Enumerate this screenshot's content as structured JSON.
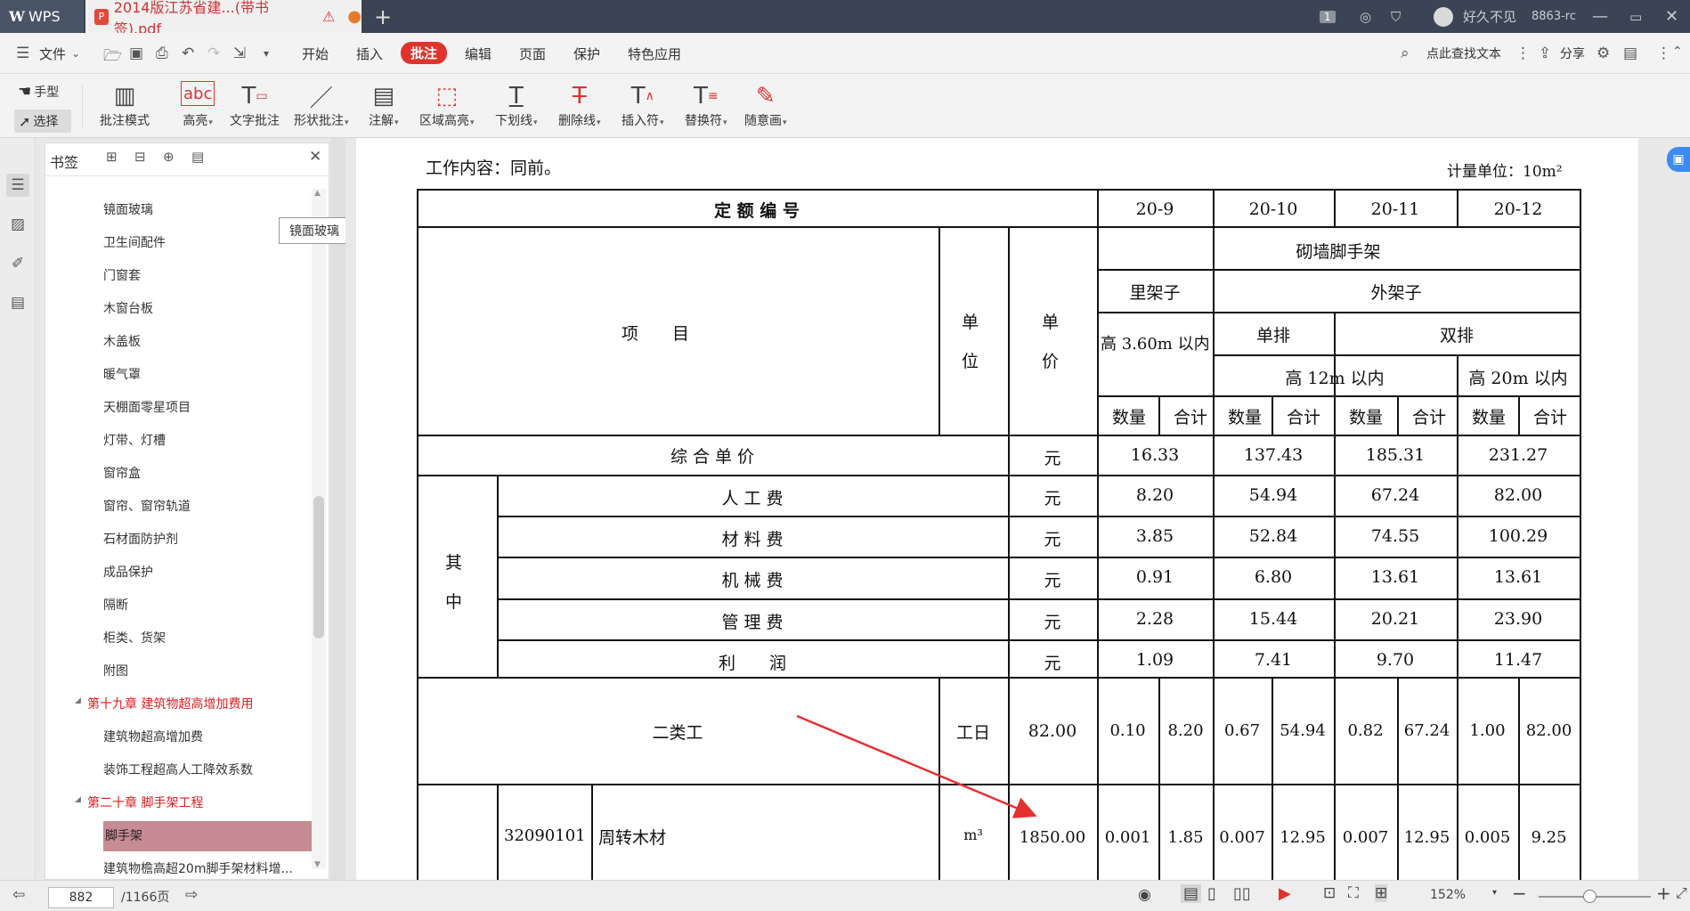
{
  "titlebar": {
    "app_name": "WPS",
    "doc_tab_title": "2014版江苏省建...(带书签).pdf",
    "user_name": "好久不见",
    "user_id": "8863-rc",
    "badge": "1"
  },
  "menubar": {
    "file_label": "文件",
    "items": [
      "开始",
      "插入",
      "批注",
      "编辑",
      "页面",
      "保护",
      "特色应用"
    ],
    "active_item": "批注",
    "search_label": "点此查找文本",
    "share_label": "分享"
  },
  "toolbar": {
    "hand_label": "手型",
    "select_label": "选择",
    "tools": [
      "批注模式",
      "高亮",
      "文字批注",
      "形状批注",
      "注解",
      "区域高亮",
      "下划线",
      "删除线",
      "插入符",
      "替换符",
      "随意画"
    ]
  },
  "bookmarks": {
    "title": "书签",
    "tooltip": "镜面玻璃",
    "items": [
      {
        "label": "镜面玻璃",
        "level": 2
      },
      {
        "label": "卫生间配件",
        "level": 2
      },
      {
        "label": "门窗套",
        "level": 2
      },
      {
        "label": "木窗台板",
        "level": 2
      },
      {
        "label": "木盖板",
        "level": 2
      },
      {
        "label": "暖气罩",
        "level": 2
      },
      {
        "label": "天棚面零星项目",
        "level": 2
      },
      {
        "label": "灯带、灯槽",
        "level": 2
      },
      {
        "label": "窗帘盒",
        "level": 2
      },
      {
        "label": "窗帘、窗帘轨道",
        "level": 2
      },
      {
        "label": "石材面防护剂",
        "level": 2
      },
      {
        "label": "成品保护",
        "level": 2
      },
      {
        "label": "隔断",
        "level": 2
      },
      {
        "label": "柜类、货架",
        "level": 2
      },
      {
        "label": "附图",
        "level": 2
      },
      {
        "label": "第十九章 建筑物超高增加费用",
        "level": 1
      },
      {
        "label": "建筑物超高增加费",
        "level": 2
      },
      {
        "label": "装饰工程超高人工降效系数",
        "level": 2
      },
      {
        "label": "第二十章 脚手架工程",
        "level": 1
      },
      {
        "label": "脚手架",
        "level": 2,
        "selected": true
      },
      {
        "label": "建筑物檐高超20m脚手架材料增...",
        "level": 2
      }
    ]
  },
  "document": {
    "work_content": "工作内容：同前。",
    "unit_note": "计量单位：10m²",
    "quota_label": "定 额 编 号",
    "codes": [
      "20-9",
      "20-10",
      "20-11",
      "20-12"
    ],
    "category": "砌墙脚手架",
    "inner_frame": "里架子",
    "outer_frame": "外架子",
    "inner_height": "高 3.60m 以内",
    "single_row": "单排",
    "double_row": "双排",
    "h12": "高 12m 以内",
    "h20": "高 20m 以内",
    "item_label": "项　　目",
    "unit_label": "单 位",
    "price_label": "单 价",
    "qty_label": "数量",
    "sum_label": "合计",
    "composite_label": "综 合 单 价",
    "composite_unit": "元",
    "composite_values": [
      "16.33",
      "137.43",
      "185.31",
      "231.27"
    ],
    "of_which": "其 中",
    "cost_rows": [
      {
        "name": "人 工 费",
        "unit": "元",
        "values": [
          "8.20",
          "54.94",
          "67.24",
          "82.00"
        ]
      },
      {
        "name": "材 料 费",
        "unit": "元",
        "values": [
          "3.85",
          "52.84",
          "74.55",
          "100.29"
        ]
      },
      {
        "name": "机 械 费",
        "unit": "元",
        "values": [
          "0.91",
          "6.80",
          "13.61",
          "13.61"
        ]
      },
      {
        "name": "管 理 费",
        "unit": "元",
        "values": [
          "2.28",
          "15.44",
          "20.21",
          "23.90"
        ]
      },
      {
        "name": "利　　润",
        "unit": "元",
        "values": [
          "1.09",
          "7.41",
          "9.70",
          "11.47"
        ]
      }
    ],
    "labor_row": {
      "name": "二类工",
      "unit": "工日",
      "price": "82.00",
      "cells": [
        "0.10",
        "8.20",
        "0.67",
        "54.94",
        "0.82",
        "67.24",
        "1.00",
        "82.00"
      ]
    },
    "material_row": {
      "code": "32090101",
      "name": "周转木材",
      "unit": "m³",
      "price": "1850.00",
      "cells": [
        "0.001",
        "1.85",
        "0.007",
        "12.95",
        "0.007",
        "12.95",
        "0.005",
        "9.25"
      ]
    }
  },
  "statusbar": {
    "current_page": "882",
    "total_pages": "/1166页",
    "zoom": "152%"
  },
  "colors": {
    "accent": "#e0332d",
    "chapter": "#d62020",
    "selected_bookmark": "#c78b93",
    "arrow": "#e63030"
  }
}
